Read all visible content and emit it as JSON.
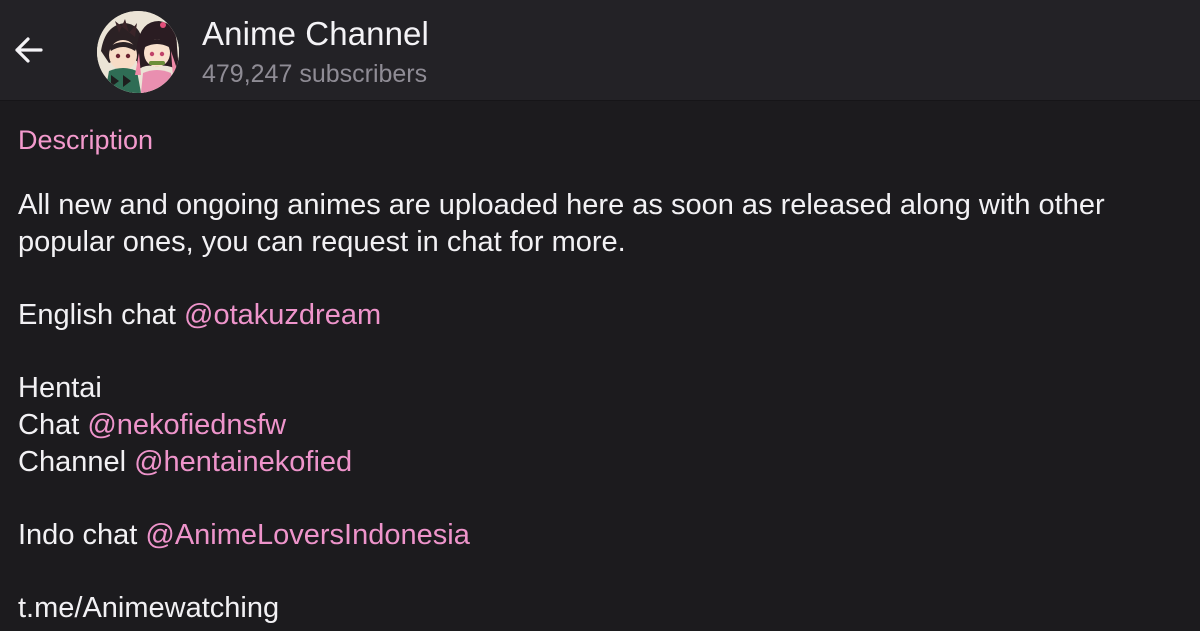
{
  "header": {
    "back_icon": "arrow-left-icon",
    "avatar_icon": "channel-avatar-image",
    "title": "Anime Channel",
    "subtitle": "479,247 subscribers"
  },
  "description": {
    "label": "Description",
    "intro_line1": "All new and ongoing animes are uploaded here as soon as released along with other",
    "intro_line2": "popular ones,  you can request in chat for more.",
    "english_chat_text": "English chat ",
    "english_chat_mention": "@otakuzdream",
    "hentai_heading": "Hentai",
    "hentai_chat_text": "Chat ",
    "hentai_chat_mention": "@nekofiednsfw",
    "hentai_channel_text": "Channel ",
    "hentai_channel_mention": "@hentainekofied",
    "indo_chat_text": "Indo chat ",
    "indo_chat_mention": "@AnimeLoversIndonesia",
    "link": "t.me/Animewatching"
  },
  "colors": {
    "background": "#1c1b1e",
    "header_background": "#232226",
    "accent_pink": "#f39acd",
    "text_primary": "#f2f1f4",
    "text_secondary": "#8f8c95"
  }
}
